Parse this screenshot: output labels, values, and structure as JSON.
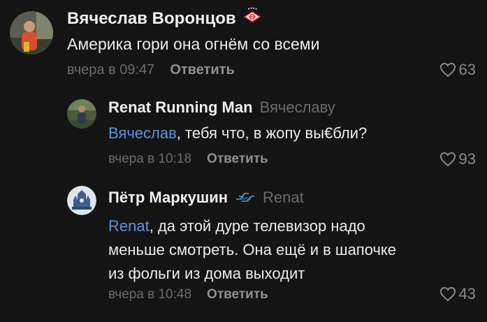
{
  "comments": [
    {
      "author": "Вячеслав Воронцов",
      "badge_icon": "spartak-logo-icon",
      "reply_to": "",
      "mention": "",
      "text": "Америка гори она огнём со всеми",
      "time": "вчера в 09:47",
      "reply_label": "Ответить",
      "likes": "63"
    },
    {
      "author": "Renat Running Man",
      "badge_icon": "",
      "reply_to": "Вячеславу",
      "mention": "Вячеслав",
      "text": ", тебя что, в жопу вы€бли?",
      "time": "вчера в 10:18",
      "reply_label": "Ответить",
      "likes": "93"
    },
    {
      "author": "Пётр Маркушин",
      "badge_icon": "zenit-logo-icon",
      "reply_to": "Renat",
      "mention": "Renat",
      "text": ", да этой дуре телевизор надо\nменьше смотреть. Она ещё и в шапочке\nиз фольги  из дома выходит",
      "time": "вчера в 10:48",
      "reply_label": "Ответить",
      "likes": "43"
    }
  ],
  "colors": {
    "background": "#141414",
    "text": "#ececec",
    "muted": "#6b6b6b",
    "mention": "#5e92d8",
    "spartak_red": "#d8262d"
  }
}
